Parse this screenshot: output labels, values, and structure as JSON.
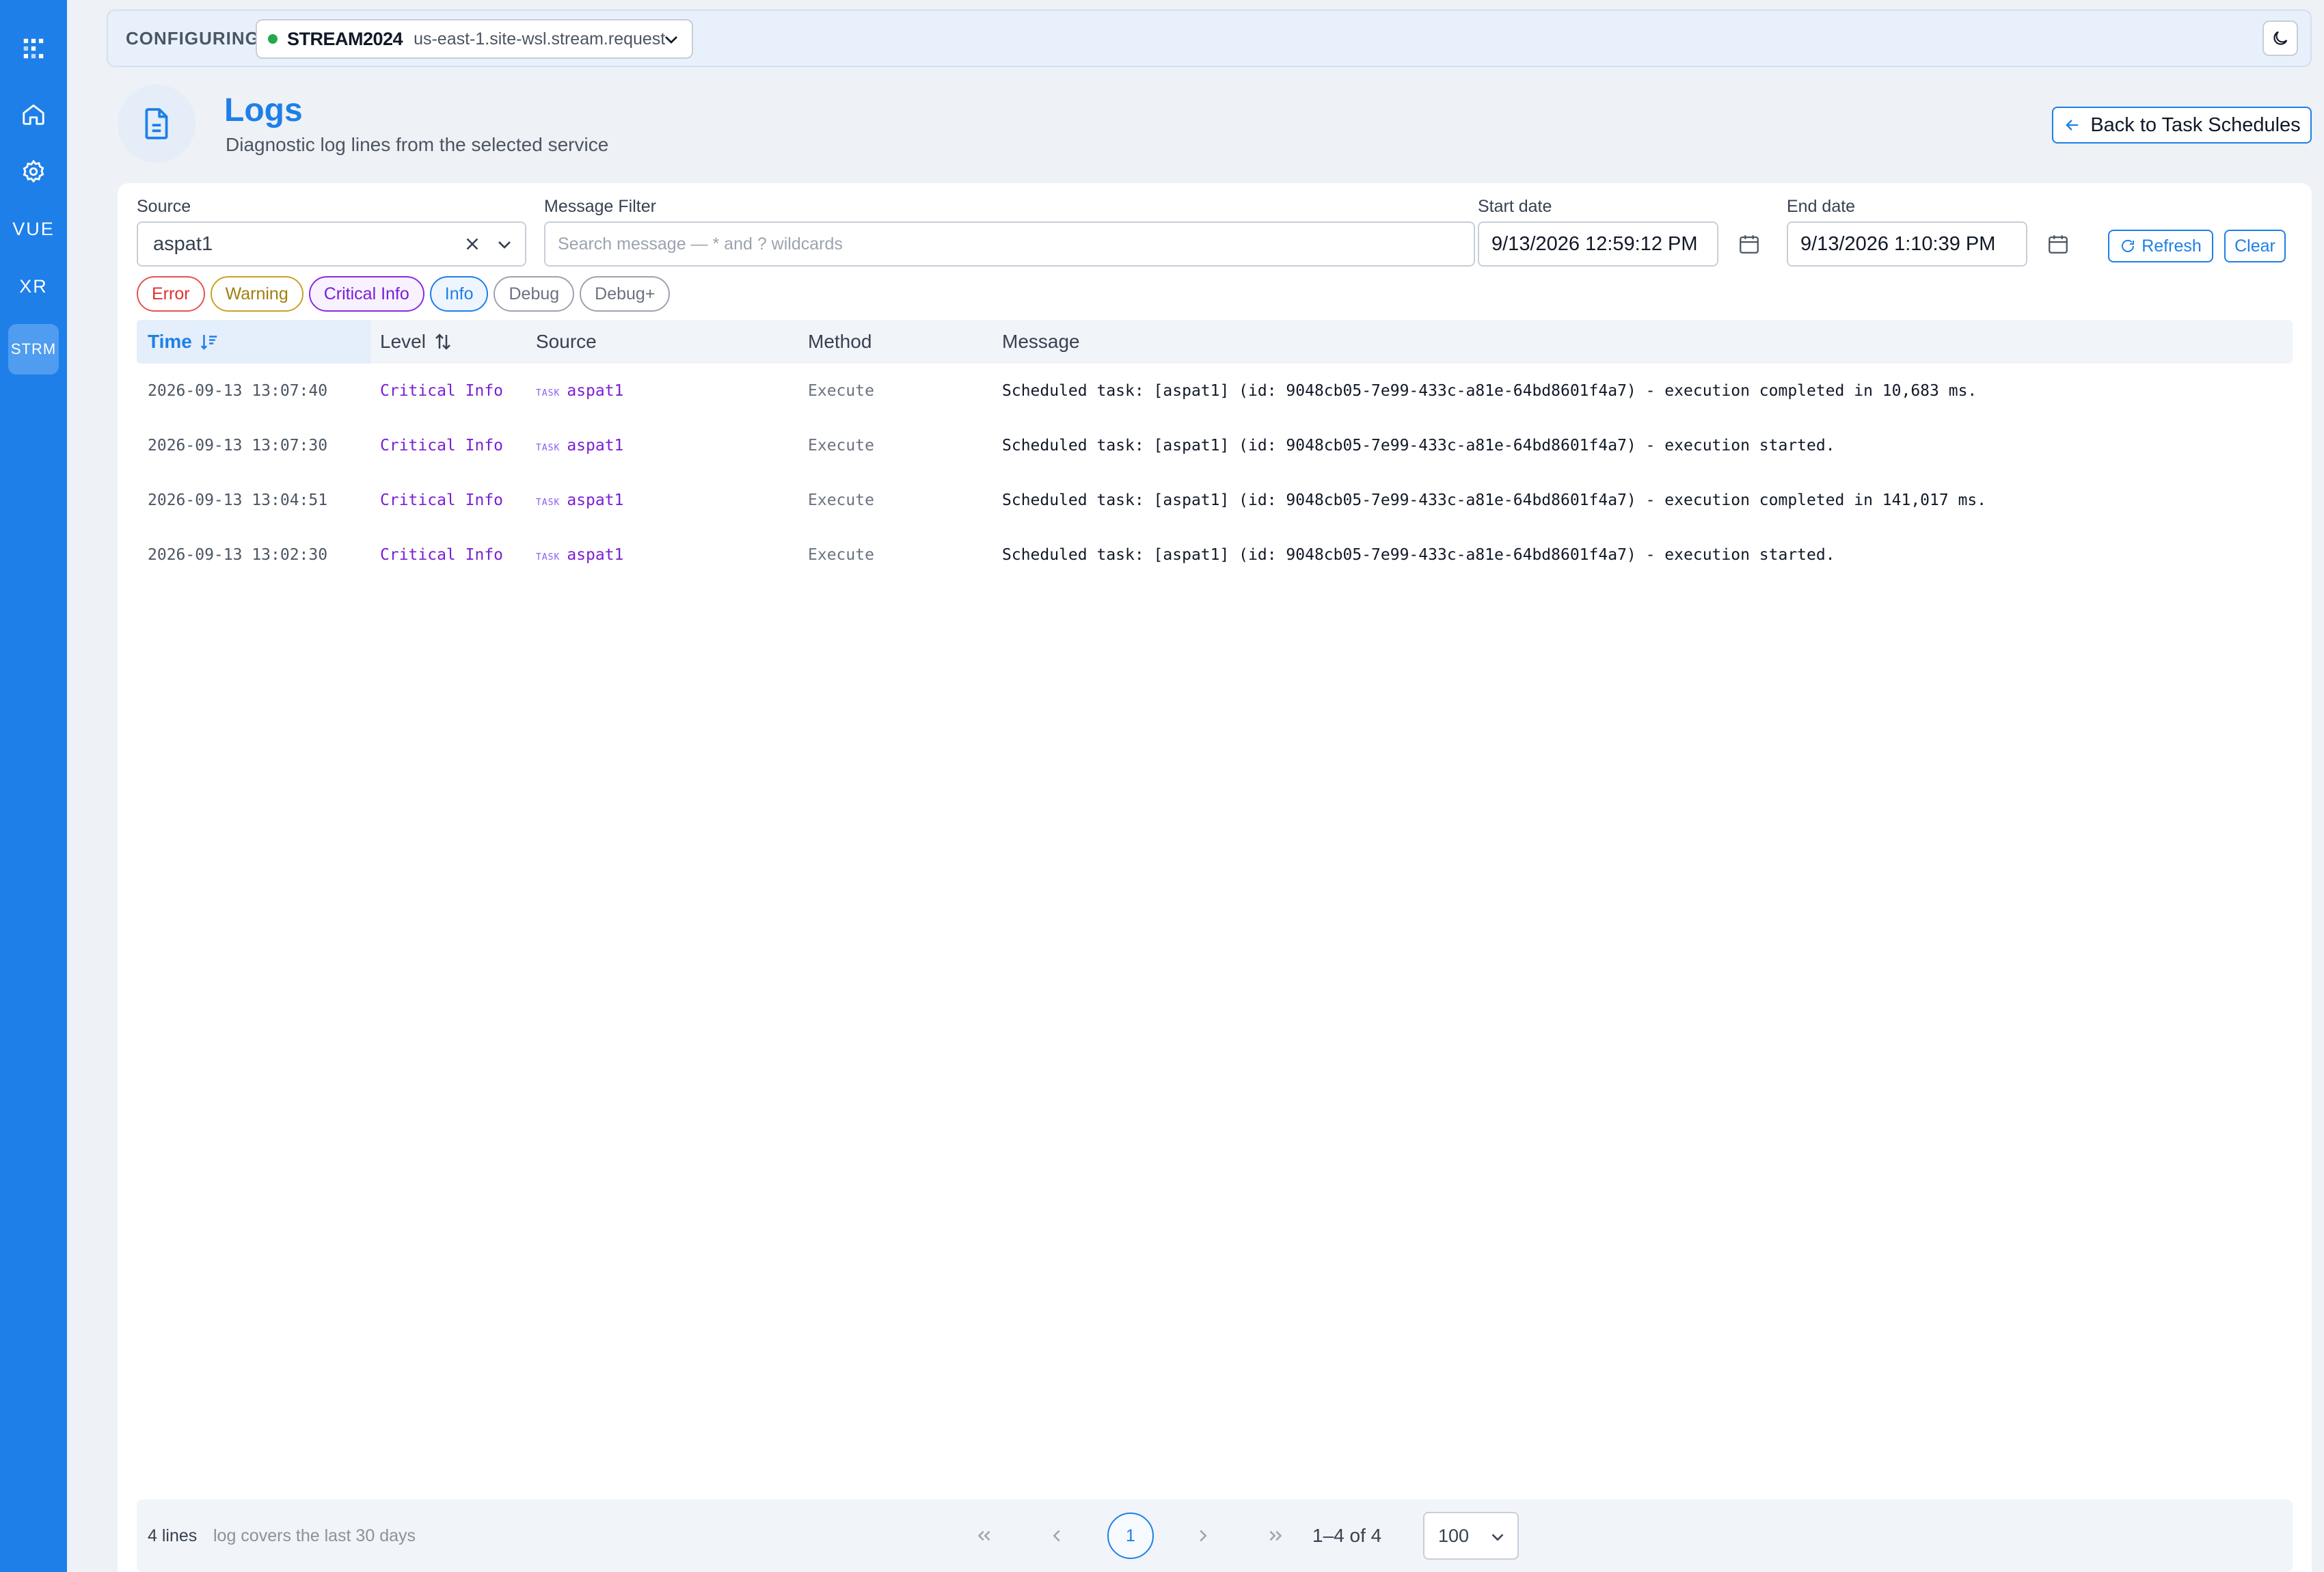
{
  "rail": {
    "items": [
      {
        "name": "logo-icon"
      },
      {
        "name": "home-icon"
      },
      {
        "name": "gear-icon"
      },
      {
        "label": "VUE"
      },
      {
        "label": "XR"
      },
      {
        "label": "STRM"
      }
    ]
  },
  "topbar": {
    "label": "CONFIGURING",
    "env_name": "STREAM2024",
    "env_host": "us-east-1.site-wsl.stream.request",
    "status_color": "#22a94b"
  },
  "header": {
    "title": "Logs",
    "subtitle": "Diagnostic log lines from the selected service",
    "back_label": "Back to Task Schedules"
  },
  "filters": {
    "source_label": "Source",
    "source_value": "aspat1",
    "message_label": "Message Filter",
    "message_placeholder": "Search message — * and ? wildcards",
    "start_label": "Start date",
    "start_value": "9/13/2026 12:59:12 PM",
    "end_label": "End date",
    "end_value": "9/13/2026 1:10:39 PM",
    "refresh_label": "Refresh",
    "clear_label": "Clear",
    "levels": [
      "Error",
      "Warning",
      "Critical Info",
      "Info",
      "Debug",
      "Debug+"
    ]
  },
  "table": {
    "columns": [
      "Time",
      "Level",
      "Source",
      "Method",
      "Message"
    ],
    "rows": [
      {
        "time": "2026-09-13 13:07:40",
        "level": "Critical Info",
        "tag": "TASK",
        "source": "aspat1",
        "method": "Execute",
        "message": "Scheduled task: [aspat1] (id: 9048cb05-7e99-433c-a81e-64bd8601f4a7) - execution completed in 10,683 ms."
      },
      {
        "time": "2026-09-13 13:07:30",
        "level": "Critical Info",
        "tag": "TASK",
        "source": "aspat1",
        "method": "Execute",
        "message": "Scheduled task: [aspat1] (id: 9048cb05-7e99-433c-a81e-64bd8601f4a7) - execution started."
      },
      {
        "time": "2026-09-13 13:04:51",
        "level": "Critical Info",
        "tag": "TASK",
        "source": "aspat1",
        "method": "Execute",
        "message": "Scheduled task: [aspat1] (id: 9048cb05-7e99-433c-a81e-64bd8601f4a7) - execution completed in 141,017 ms."
      },
      {
        "time": "2026-09-13 13:02:30",
        "level": "Critical Info",
        "tag": "TASK",
        "source": "aspat1",
        "method": "Execute",
        "message": "Scheduled task: [aspat1] (id: 9048cb05-7e99-433c-a81e-64bd8601f4a7) - execution started."
      }
    ]
  },
  "footer": {
    "lines": "4 lines",
    "note": "log covers the last 30 days",
    "current_page": "1",
    "range": "1–4 of 4",
    "per_page": "100"
  },
  "colors": {
    "accent": "#1e7fe8",
    "critical": "#7a1fd6",
    "error": "#e03131",
    "warning": "#a07f0e"
  }
}
